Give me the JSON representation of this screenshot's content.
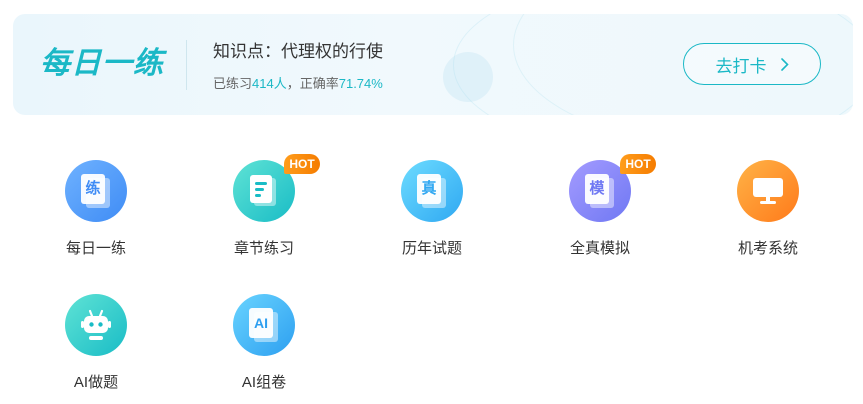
{
  "banner": {
    "brand": "每日一练",
    "topic": "知识点：代理权的行使",
    "stats_prefix": "已练习",
    "stats_count": "414人",
    "stats_mid": "，正确率",
    "stats_rate": "71.74%",
    "checkin_label": "去打卡"
  },
  "tiles": [
    {
      "label": "每日一练",
      "icon": "practice-book-icon",
      "glyph": "练",
      "hot": ""
    },
    {
      "label": "章节练习",
      "icon": "chapter-document-icon",
      "glyph": "",
      "hot": "HOT"
    },
    {
      "label": "历年试题",
      "icon": "past-exams-book-icon",
      "glyph": "真",
      "hot": ""
    },
    {
      "label": "全真模拟",
      "icon": "mock-exam-book-icon",
      "glyph": "模",
      "hot": "HOT"
    },
    {
      "label": "机考系统",
      "icon": "computer-monitor-icon",
      "glyph": "",
      "hot": ""
    },
    {
      "label": "AI做题",
      "icon": "robot-icon",
      "glyph": "",
      "hot": ""
    },
    {
      "label": "AI组卷",
      "icon": "ai-paper-icon",
      "glyph": "AI",
      "hot": ""
    }
  ],
  "colors": {
    "accent": "#1bb8c6",
    "hot": "#f57c00"
  }
}
